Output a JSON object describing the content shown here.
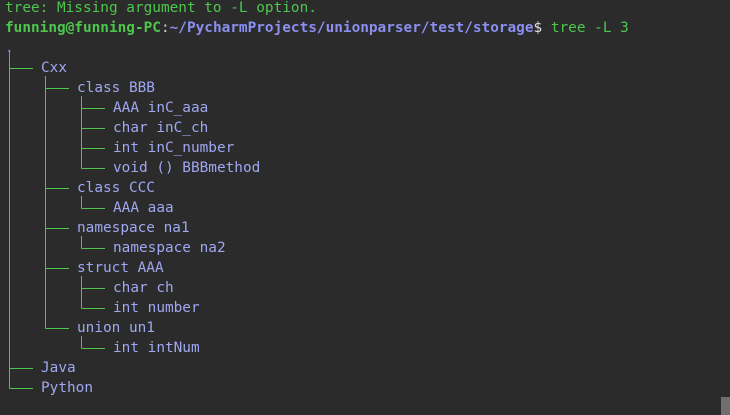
{
  "terminal": {
    "error_line": "tree: Missing argument to -L option.",
    "prompt_user": "funning@funning-PC",
    "prompt_colon": ":",
    "prompt_path": "~/PycharmProjects/unionparser/test/storage",
    "prompt_dollar": "$ ",
    "command": "tree -L 3",
    "root": "."
  },
  "tree": {
    "cxx": "Cxx",
    "class_bbb": "class BBB",
    "aaa_inc_aaa": "AAA inC_aaa",
    "char_inc_ch": "char inC_ch",
    "int_inc_number": "int inC_number",
    "void_bbbmethod": "void () BBBmethod",
    "class_ccc": "class CCC",
    "aaa_aaa": "AAA aaa",
    "namespace_na1": "namespace na1",
    "namespace_na2": "namespace na2",
    "struct_aaa": "struct AAA",
    "char_ch": "char ch",
    "int_number": "int number",
    "union_un1": "union un1",
    "int_intnum": "int intNum",
    "java": "Java",
    "python": "Python"
  },
  "colors": {
    "background": "#2b2b2b",
    "green": "#4ec64e",
    "blue": "#8a8ff0",
    "text": "#9fa7f0"
  }
}
